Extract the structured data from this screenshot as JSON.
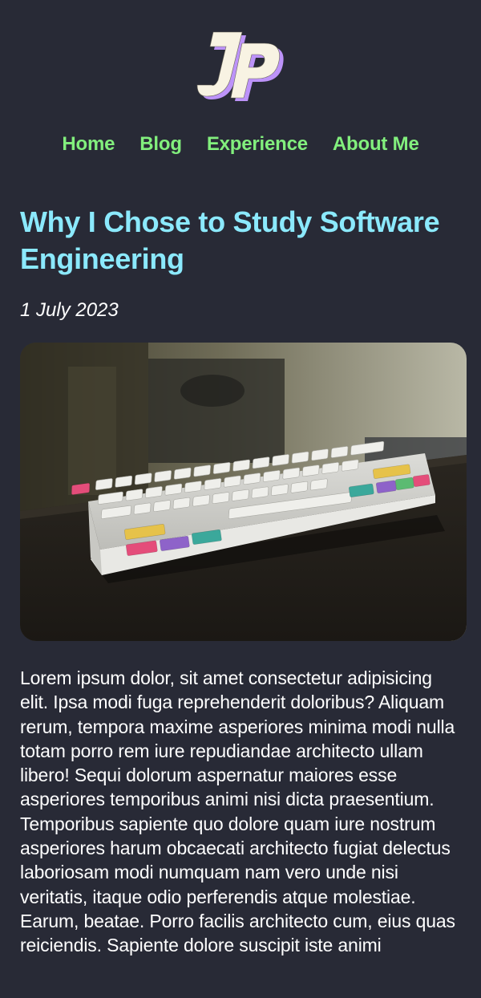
{
  "logo": {
    "text": "JP",
    "icon": "jp-monogram-logo"
  },
  "nav": {
    "items": [
      {
        "label": "Home"
      },
      {
        "label": "Blog"
      },
      {
        "label": "Experience"
      },
      {
        "label": "About Me"
      }
    ]
  },
  "post": {
    "title": "Why I Chose to Study Software Engineering",
    "date": "1 July 2023",
    "image_subject": "mechanical keyboard on desk",
    "body": "Lorem ipsum dolor, sit amet consectetur adipisicing elit. Ipsa modi fuga reprehenderit doloribus? Aliquam rerum, tempora maxime asperiores minima modi nulla totam porro rem iure repudiandae architecto ullam libero! Sequi dolorum aspernatur maiores esse asperiores temporibus animi nisi dicta praesentium. Temporibus sapiente quo dolore quam iure nostrum asperiores harum obcaecati architecto fugiat delectus laboriosam modi numquam nam vero unde nisi veritatis, itaque odio perferendis atque molestiae. Earum, beatae. Porro facilis architecto cum, eius quas reiciendis. Sapiente dolore suscipit iste animi"
  },
  "colors": {
    "background": "#282a36",
    "nav": "#82ef7d",
    "title": "#8be9fd",
    "text": "#ffffff"
  }
}
